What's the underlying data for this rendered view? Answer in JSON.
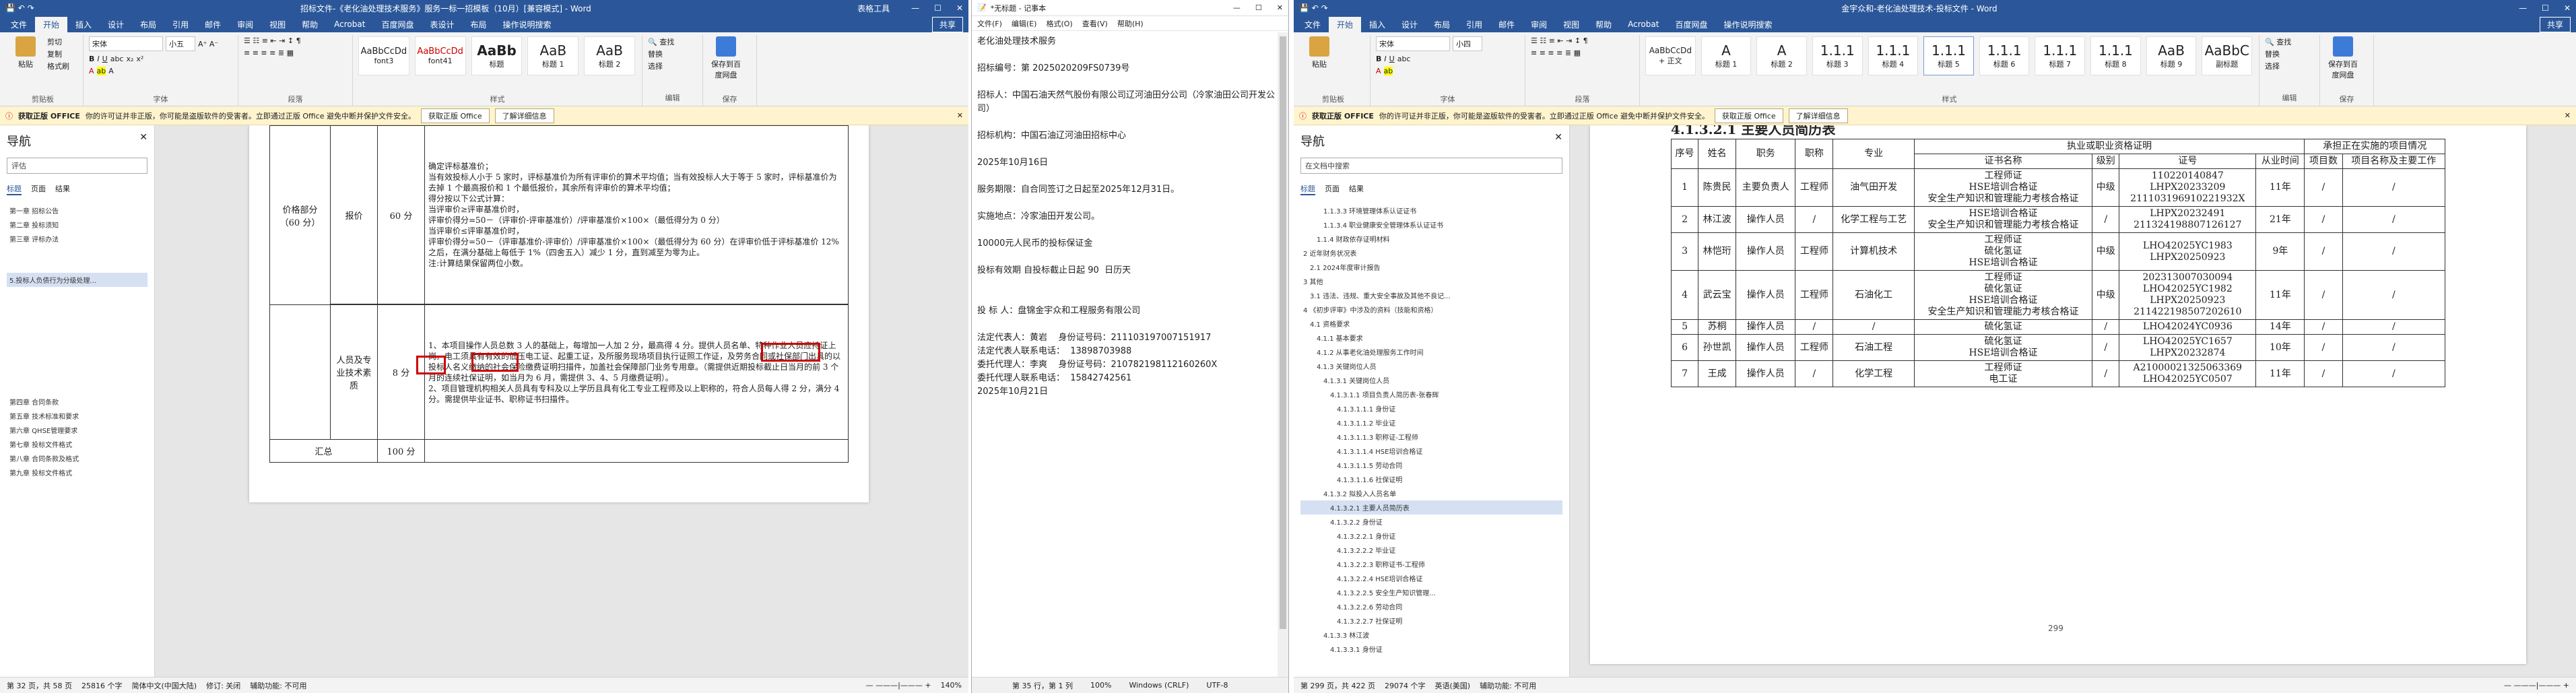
{
  "win1": {
    "title": "招标文件-《老化油处理技术服务》服务一标一招模板（10月）[兼容模式] - Word",
    "table_tools": "表格工具",
    "menu": [
      "文件",
      "开始",
      "插入",
      "设计",
      "布局",
      "引用",
      "邮件",
      "审阅",
      "视图",
      "帮助",
      "Acrobat",
      "百度网盘",
      "表设计",
      "布局",
      "操作说明搜索"
    ],
    "share": "共享",
    "ribbon": {
      "paste": "粘贴",
      "cut": "剪切",
      "copy": "复制",
      "format_painter": "格式刷",
      "clipboard": "剪贴板",
      "font_name": "宋体",
      "font_size": "小五",
      "font_group": "字体",
      "para_group": "段落",
      "styles": [
        {
          "s": "AaBbCcDd",
          "l": "font3"
        },
        {
          "s": "AaBbCcDd",
          "l": "font41"
        },
        {
          "s": "AaBb",
          "l": "标题"
        },
        {
          "s": "AaB",
          "l": "标题 1"
        },
        {
          "s": "AaB",
          "l": "标题 2"
        }
      ],
      "styles_group": "样式",
      "find": "查找",
      "replace": "替换",
      "select": "选择",
      "edit_group": "编辑",
      "save_baidu": "保存到百度网盘",
      "save_group": "保存"
    },
    "msg": {
      "title": "获取正版 OFFICE",
      "text": "你的许可证并非正版，你可能是盗版软件的受害者。立即通过正版 Office 避免中断并保护文件安全。",
      "btn1": "获取正版 Office",
      "btn2": "了解详细信息"
    },
    "nav": {
      "title": "导航",
      "search": "评估",
      "tabs": [
        "标题",
        "页面",
        "结果"
      ],
      "items": [
        "第一章 招标公告",
        "第二章 投标须知",
        "第三章 评标办法",
        "5.投标人负债行为分级处理...",
        "第四章 合同条款",
        "第五章 技术标准和要求",
        "第六章 QHSE管理要求",
        "第七章 投标文件格式",
        "第八章 合同条款及格式",
        "第九章 投标文件格式"
      ]
    },
    "table": {
      "top_text": [
        "确定评标基准价；",
        "当有效投标人小于 5 家时，评标基准价为所有评审价的算术平均值；当有效投标人大于等于 5 家时，评标基准价为去掉 1 个最高报价和 1 个最低报价，其余所有评审价的算术平均值；",
        "得分按以下公式计算：",
        "当评审价≥评审基准价时，",
        "评审价得分=50－（评审价-评审基准价）/评审基准价×100×（最低得分为 0 分）",
        "当评审价≤评审基准价时，",
        "评审价得分=50－（评审基准价-评审价）/评审基准价×100×（最低得分为 60 分）在评审价低于评标基准价 12%之后，在满分基础上每低于 1%（四舍五入）减少 1 分，直到减至为零为止。",
        "注:计算结果保留两位小数。"
      ],
      "price_label": "价格部分（60 分）",
      "quote": "报价",
      "quote_score": "60 分",
      "staff_label": "人员及专业技术素质",
      "staff_score": "8 分",
      "staff_text": [
        "1、本项目操作人员总数 3 人的基础上，每增加一人加 2 分，最高得 4 分。提供人员名单、特种作业人员应持证上岗。电工须具有有效的低压电工证、起重工证，及所服务现场项目执行证照工作证，及劳务合同或社保部门出具的以投标人名义缴纳的社会保险缴费证明扫描件，加盖社会保障部门业务专用章。（需提供近期投标截止日当月的前 3 个月的连续社保证明，如当月为 6 月，需提供 3、4、5 月缴费证明）。",
        "2、项目管理机构相关人员具有专科及以上学历且具有化工专业工程师及以上职称的，符合人员每人得 2 分，满分 4 分。需提供毕业证书、职称证书扫描件。"
      ],
      "total_label": "汇总",
      "total_score": "100 分"
    },
    "status": {
      "page": "第 32 页，共 58 页",
      "words": "25816 个字",
      "lang": "简体中文(中国大陆)",
      "track": "修订: 关闭",
      "access": "辅助功能: 不可用",
      "zoom": "140%"
    }
  },
  "notepad": {
    "title": "*无标题 - 记事本",
    "menu": [
      "文件(F)",
      "编辑(E)",
      "格式(O)",
      "查看(V)",
      "帮助(H)"
    ],
    "lines": [
      "老化油处理技术服务",
      "",
      "招标编号：第 2025020209FS0739号",
      "",
      "招标人：中国石油天然气股份有限公司辽河油田分公司（冷家油田公司开发公司）",
      "",
      "招标机构：中国石油辽河油田招标中心",
      "",
      "2025年10月16日",
      "",
      "服务期限：自合同签订之日起至2025年12月31日。",
      "",
      "实施地点：冷家油田开发公司。",
      "",
      "10000元人民币的投标保证金",
      "",
      "投标有效期 自投标截止日起 90  日历天",
      "",
      "",
      "投 标 人：盘锦金宇众和工程服务有限公司",
      "",
      "法定代表人：黄岩    身份证号码：211103197007151917",
      "法定代表人联系电话：  13898703988",
      "委托代理人：李爽    身份证号码：210782198112160260X",
      "委托代理人联系电话：  15842742561",
      "2025年10月21日"
    ],
    "status": {
      "pos": "第 35 行，第 1 列",
      "zoom": "100%",
      "eol": "Windows (CRLF)",
      "enc": "UTF-8"
    }
  },
  "win2": {
    "title": "金宇众和-老化油处理技术-投标文件 - Word",
    "menu": [
      "文件",
      "开始",
      "插入",
      "设计",
      "布局",
      "引用",
      "邮件",
      "审阅",
      "视图",
      "帮助",
      "Acrobat",
      "百度网盘",
      "操作说明搜索"
    ],
    "share": "共享",
    "ribbon": {
      "font_name": "宋体",
      "font_size": "小四",
      "styles": [
        {
          "s": "AaBbCcDd",
          "l": "+ 正文"
        },
        {
          "s": "A",
          "l": "标题 1"
        },
        {
          "s": "A",
          "l": "标题 2"
        },
        {
          "s": "1.1.1",
          "l": "标题 3"
        },
        {
          "s": "1.1.1",
          "l": "标题 4"
        },
        {
          "s": "1.1.1",
          "l": "标题 5"
        },
        {
          "s": "1.1.1",
          "l": "标题 6"
        },
        {
          "s": "1.1.1",
          "l": "标题 7"
        },
        {
          "s": "1.1.1",
          "l": "标题 8"
        },
        {
          "s": "AaB",
          "l": "标题 9"
        },
        {
          "s": "AaBbC",
          "l": "副标题"
        }
      ]
    },
    "nav": {
      "title": "导航",
      "search": "在文档中搜索",
      "tabs": [
        "标题",
        "页面",
        "结果"
      ],
      "items": [
        "1.1.3.3 环境管理体系认证证书",
        "1.1.3.4 职业健康安全管理体系认证证书",
        "1.1.4 财政依存证明材料",
        "2 近年财务状况表",
        "2.1 2024年度审计报告",
        "3 其他",
        "3.1 违法、违规、重大安全事故及其他不良记...",
        "4 《初步评审》中涉及的资料（技能和资格）",
        "4.1 资格要求",
        "4.1.1 基本要求",
        "4.1.2 从事老化油处理服务工作时间",
        "4.1.3 关键岗位人员",
        "4.1.3.1 关键岗位人员",
        "4.1.3.1.1 项目负责人简历表-张春辉",
        "4.1.3.1.1.1 身份证",
        "4.1.3.1.1.2 毕业证",
        "4.1.3.1.1.3 职称证-工程师",
        "4.1.3.1.1.4 HSE培训合格证",
        "4.1.3.1.1.5 劳动合同",
        "4.1.3.1.1.6 社保证明",
        "4.1.3.2 拟投入人员名单",
        "4.1.3.2.1 主要人员简历表",
        "4.1.3.2.2 身份证",
        "4.1.3.2.2.1 身份证",
        "4.1.3.2.2.2 毕业证",
        "4.1.3.2.2.3 职称证书-工程师",
        "4.1.3.2.2.4 HSE培训合格证",
        "4.1.3.2.2.5 安全生产知识管理...",
        "4.1.3.2.2.6 劳动合同",
        "4.1.3.2.2.7 社保证明",
        "4.1.3.3 林江波",
        "4.1.3.3.1 身份证"
      ]
    },
    "doc": {
      "heading": "4.1.3.2.1 主要人员简历表",
      "headers": {
        "no": "序号",
        "name": "姓名",
        "role": "职务",
        "title": "职称",
        "major": "专业",
        "qual": "执业或职业资格证明",
        "cert": "证书名称",
        "level": "级别",
        "num": "证号",
        "years": "从业时间",
        "proj_count": "项目数",
        "projects": "承担正在实施的项目情况",
        "proj_name": "项目名称及主要工作"
      },
      "rows": [
        {
          "no": "1",
          "name": "陈贵民",
          "role": "主要负责人",
          "title": "工程师",
          "major": "油气田开发",
          "certs": "工程师证\nHSE培训合格证\n安全生产知识和管理能力考核合格证",
          "level": "中级",
          "num": "110220140847\nLHPX20233209\n211103196910221932X",
          "years": "11年",
          "pc": "/",
          "pn": "/"
        },
        {
          "no": "2",
          "name": "林江波",
          "role": "操作人员",
          "title": "/",
          "major": "化学工程与工艺",
          "certs": "HSE培训合格证\n安全生产知识和管理能力考核合格证",
          "level": "/",
          "num": "LHPX20232491\n211324198807126127",
          "years": "21年",
          "pc": "/",
          "pn": "/"
        },
        {
          "no": "3",
          "name": "林恺珩",
          "role": "操作人员",
          "title": "工程师",
          "major": "计算机技术",
          "certs": "工程师证\n硫化氢证\nHSE培训合格证",
          "level": "中级",
          "num": "LHO42025YC1983\nLHPX20250923",
          "years": "9年",
          "pc": "/",
          "pn": "/"
        },
        {
          "no": "4",
          "name": "武云宝",
          "role": "操作人员",
          "title": "工程师",
          "major": "石油化工",
          "certs": "工程师证\n硫化氢证\nHSE培训合格证\n安全生产知识和管理能力考核合格证",
          "level": "中级",
          "num": "202313007030094\nLHO42025YC1982\nLHPX20250923\n211422198507202610",
          "years": "11年",
          "pc": "/",
          "pn": "/"
        },
        {
          "no": "5",
          "name": "苏桐",
          "role": "操作人员",
          "title": "/",
          "major": "/",
          "certs": "硫化氢证",
          "level": "/",
          "num": "LHO42024YC0936",
          "years": "14年",
          "pc": "/",
          "pn": "/"
        },
        {
          "no": "6",
          "name": "孙世凯",
          "role": "操作人员",
          "title": "工程师",
          "major": "石油工程",
          "certs": "硫化氢证\nHSE培训合格证",
          "level": "/",
          "num": "LHO42025YC1657\nLHPX20232874",
          "years": "10年",
          "pc": "/",
          "pn": "/"
        },
        {
          "no": "7",
          "name": "王成",
          "role": "操作人员",
          "title": "/",
          "major": "化学工程",
          "certs": "工程师证\n电工证",
          "level": "/",
          "num": "A21000021325063369\nLHO42025YC0507",
          "years": "11年",
          "pc": "/",
          "pn": "/"
        }
      ],
      "page_no": "299"
    },
    "status": {
      "page": "第 299 页，共 422 页",
      "words": "29074 个字",
      "lang": "英语(美国)",
      "access": "辅助功能: 不可用"
    }
  }
}
